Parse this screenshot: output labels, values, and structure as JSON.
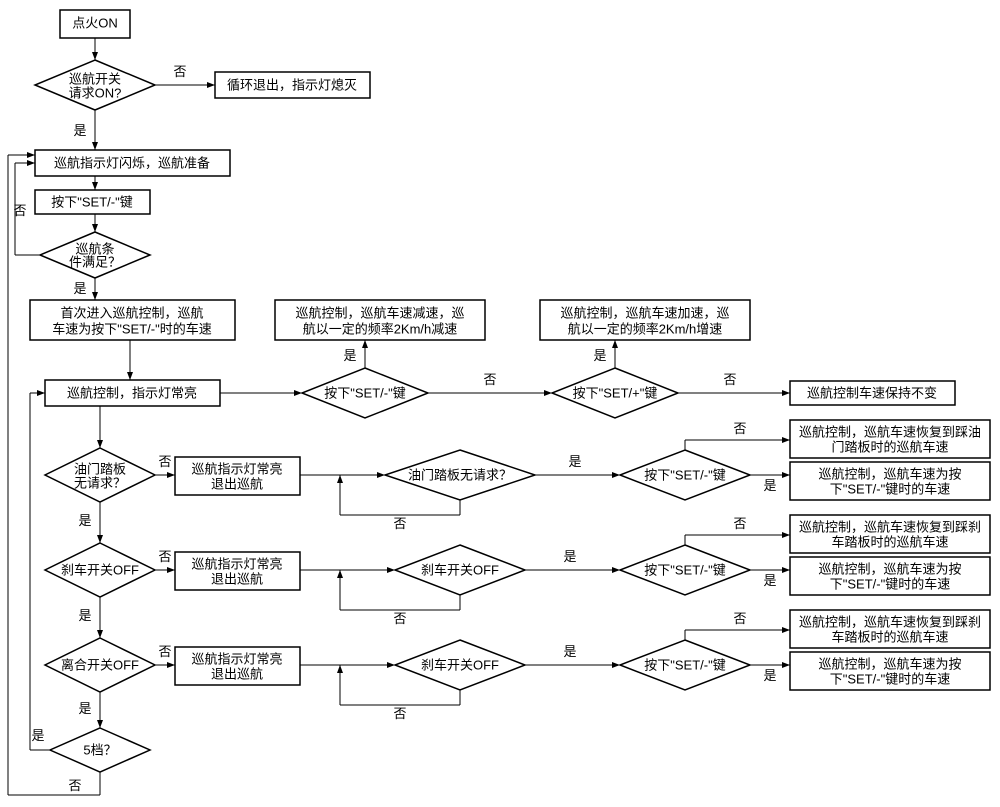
{
  "start": "点火ON",
  "d_cruise_on": "巡航开关请求ON?",
  "exit_loop": "循环退出，指示灯熄灭",
  "prepare": "巡航指示灯闪烁，巡航准备",
  "press_set1": "按下\"SET/-\"键",
  "d_cond": "巡航条件满足？",
  "first_enter_l1": "首次进入巡航控制，巡航",
  "first_enter_l2": "车速为按下\"SET/-\"时的车速",
  "decel_l1": "巡航控制，巡航车速减速，巡",
  "decel_l2": "航以一定的频率2Km/h减速",
  "accel_l1": "巡航控制，巡航车速加速，巡",
  "accel_l2": "航以一定的频率2Km/h增速",
  "cruise_on_light": "巡航控制，指示灯常亮",
  "d_press_set_minus": "按下\"SET/-\"键",
  "d_press_set_plus": "按下\"SET/+\"键",
  "keep_speed": "巡航控制车速保持不变",
  "d_throttle_none": "油门踏板无请求？",
  "light_exit_l1": "巡航指示灯常亮",
  "light_exit_l2": "退出巡航",
  "d_throttle_none2": "油门踏板无请求？",
  "d_press_set2": "按下\"SET/-\"键",
  "resume_throttle_l1": "巡航控制，巡航车速恢复到踩油",
  "resume_throttle_l2": "门踏板时的巡航车速",
  "set_throttle_l1": "巡航控制，巡航车速为按",
  "set_throttle_l2": "下\"SET/-\"键时的车速",
  "d_brake_off": "刹车开关OFF",
  "d_brake_off2": "刹车开关OFF",
  "d_press_set3": "按下\"SET/-\"键",
  "resume_brake_l1": "巡航控制，巡航车速恢复到踩刹",
  "resume_brake_l2": "车踏板时的巡航车速",
  "set_brake_l1": "巡航控制，巡航车速为按",
  "set_brake_l2": "下\"SET/-\"键时的车速",
  "d_clutch_off": "离合开关OFF",
  "d_brake_off3": "刹车开关OFF",
  "d_press_set4": "按下\"SET/-\"键",
  "resume_clutch_l1": "巡航控制，巡航车速恢复到踩刹",
  "resume_clutch_l2": "车踏板时的巡航车速",
  "set_clutch_l1": "巡航控制，巡航车速为按",
  "set_clutch_l2": "下\"SET/-\"键时的车速",
  "d_gear5": "5档？",
  "yes": "是",
  "no": "否"
}
